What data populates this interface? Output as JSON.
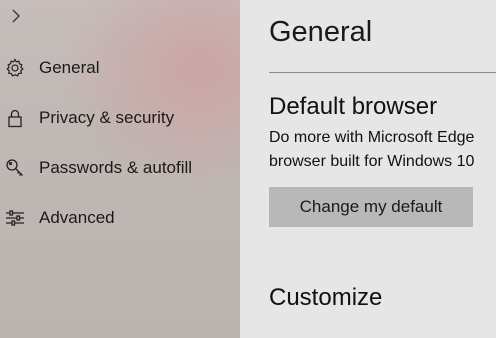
{
  "sidebar": {
    "toggle_icon": "chevron-right-icon",
    "items": [
      {
        "icon": "gear-icon",
        "label": "General"
      },
      {
        "icon": "lock-icon",
        "label": "Privacy & security"
      },
      {
        "icon": "key-icon",
        "label": "Passwords & autofill"
      },
      {
        "icon": "sliders-icon",
        "label": "Advanced"
      }
    ]
  },
  "main": {
    "title": "General",
    "default_browser": {
      "heading": "Default browser",
      "description_line1": "Do more with Microsoft Edge",
      "description_line2": "browser built for Windows 10",
      "button_label": "Change my default"
    },
    "customize": {
      "heading": "Customize"
    }
  },
  "colors": {
    "sidebar_bg": "#c0b8b4",
    "main_bg": "#e6e6e6",
    "button_bg": "#b8b8b8",
    "text": "#1a1a1a"
  }
}
